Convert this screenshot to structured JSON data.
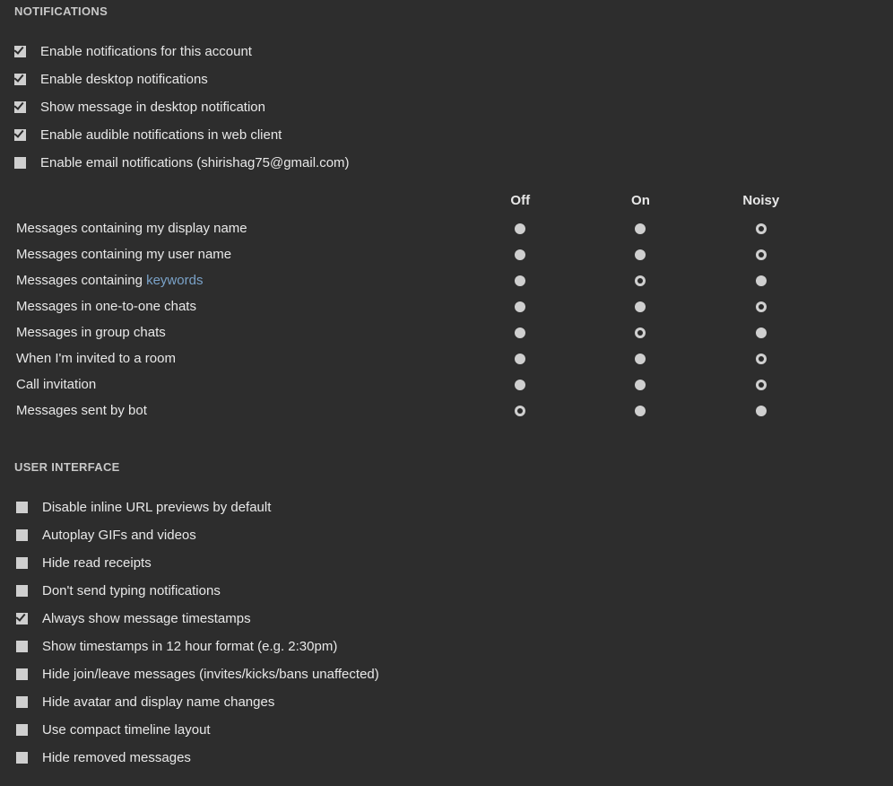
{
  "sections": {
    "notif_heading": "Notifications",
    "ui_heading": "User Interface"
  },
  "notif_checkboxes": [
    {
      "label": "Enable notifications for this account",
      "checked": true
    },
    {
      "label": "Enable desktop notifications",
      "checked": true
    },
    {
      "label": "Show message in desktop notification",
      "checked": true
    },
    {
      "label": "Enable audible notifications in web client",
      "checked": true
    },
    {
      "label": "Enable email notifications (shirishag75@gmail.com)",
      "checked": false
    }
  ],
  "rule_columns": {
    "off": "Off",
    "on": "On",
    "noisy": "Noisy"
  },
  "keywords_link": "keywords",
  "rules": [
    {
      "label": "Messages containing my display name",
      "selected": "noisy",
      "kw": false
    },
    {
      "label": "Messages containing my user name",
      "selected": "noisy",
      "kw": false
    },
    {
      "label": "Messages containing ",
      "selected": "on",
      "kw": true
    },
    {
      "label": "Messages in one-to-one chats",
      "selected": "noisy",
      "kw": false
    },
    {
      "label": "Messages in group chats",
      "selected": "on",
      "kw": false
    },
    {
      "label": "When I'm invited to a room",
      "selected": "noisy",
      "kw": false
    },
    {
      "label": "Call invitation",
      "selected": "noisy",
      "kw": false
    },
    {
      "label": "Messages sent by bot",
      "selected": "off",
      "kw": false
    }
  ],
  "ui_checkboxes": [
    {
      "label": "Disable inline URL previews by default",
      "checked": false
    },
    {
      "label": "Autoplay GIFs and videos",
      "checked": false
    },
    {
      "label": "Hide read receipts",
      "checked": false
    },
    {
      "label": "Don't send typing notifications",
      "checked": false
    },
    {
      "label": "Always show message timestamps",
      "checked": true
    },
    {
      "label": "Show timestamps in 12 hour format (e.g. 2:30pm)",
      "checked": false
    },
    {
      "label": "Hide join/leave messages (invites/kicks/bans unaffected)",
      "checked": false
    },
    {
      "label": "Hide avatar and display name changes",
      "checked": false
    },
    {
      "label": "Use compact timeline layout",
      "checked": false
    },
    {
      "label": "Hide removed messages",
      "checked": false
    }
  ]
}
